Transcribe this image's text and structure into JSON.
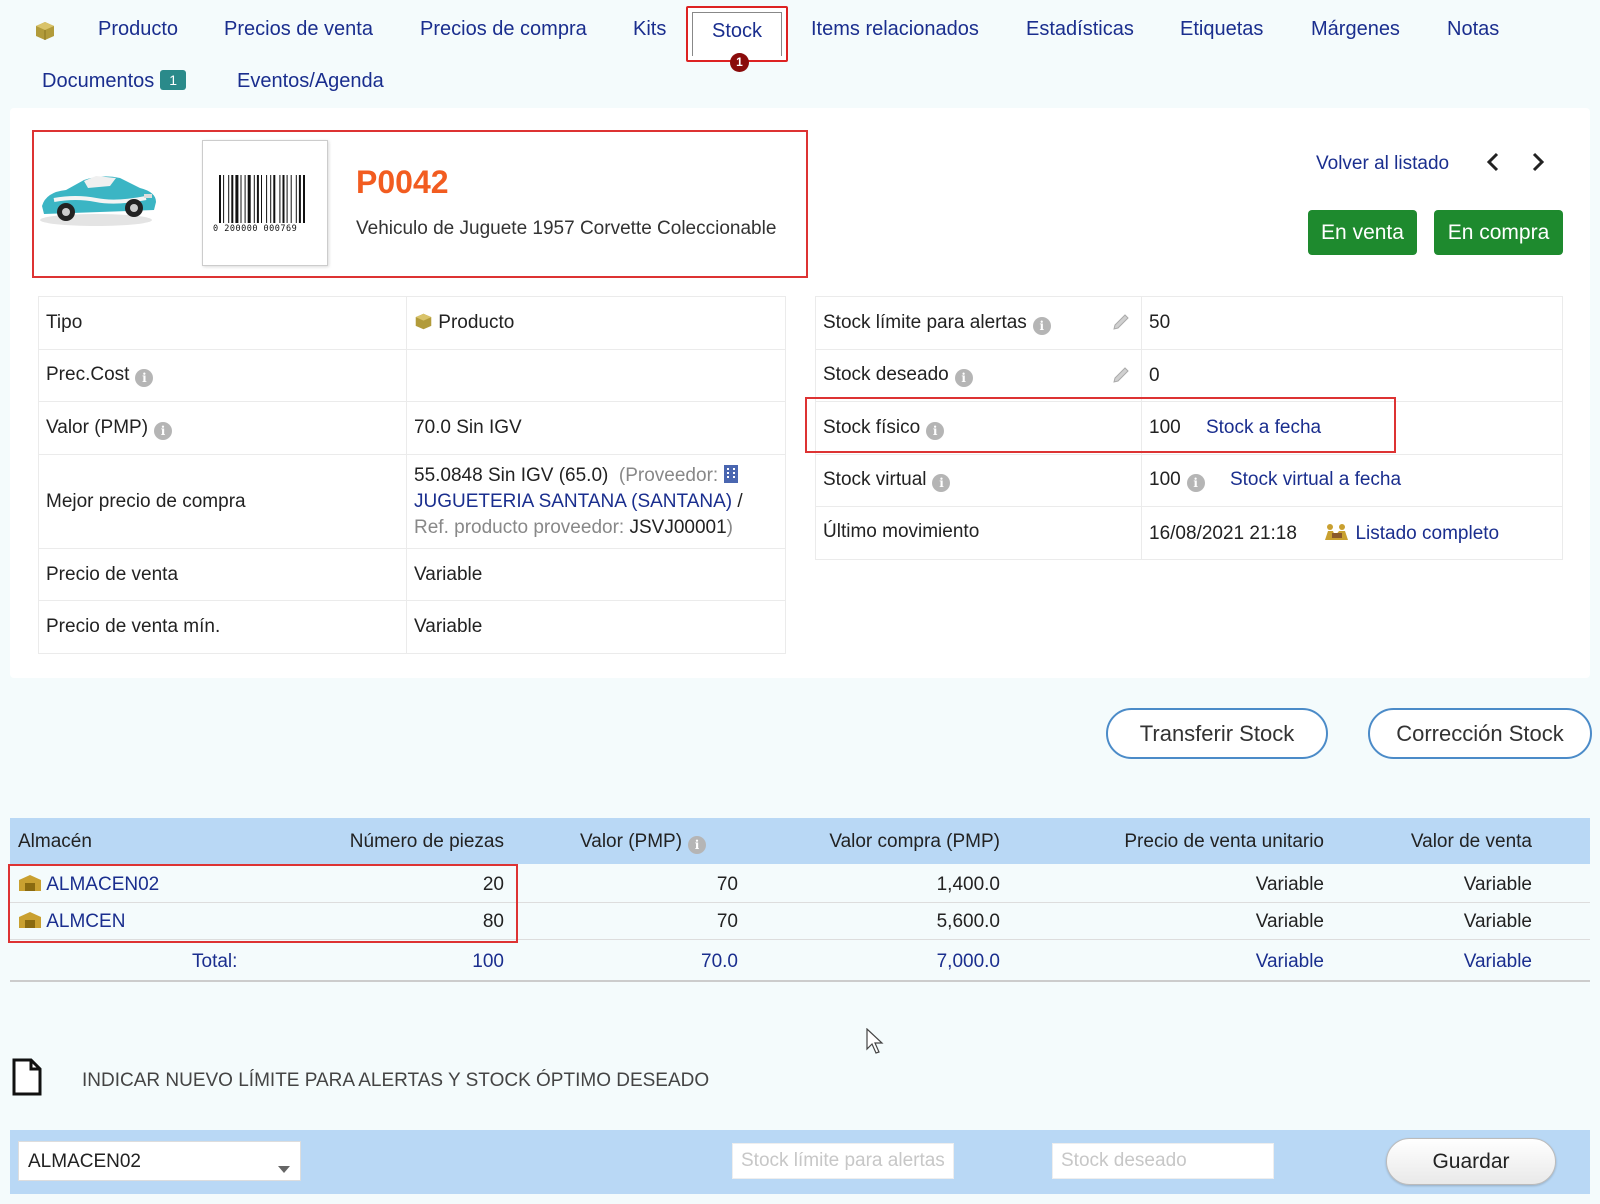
{
  "tabs": [
    {
      "label": "Producto"
    },
    {
      "label": "Precios de venta"
    },
    {
      "label": "Precios de compra"
    },
    {
      "label": "Kits"
    },
    {
      "label": "Stock",
      "active": true
    },
    {
      "label": "Items relacionados"
    },
    {
      "label": "Estadísticas"
    },
    {
      "label": "Etiquetas"
    },
    {
      "label": "Márgenes"
    },
    {
      "label": "Notas"
    },
    {
      "label": "Documentos",
      "badge": "1"
    },
    {
      "label": "Eventos/Agenda"
    }
  ],
  "active_tab_indicator": "1",
  "product": {
    "ref": "P0042",
    "description": "Vehiculo de Juguete 1957 Corvette Coleccionable",
    "barcode_number": "0 200000 000769"
  },
  "nav": {
    "back_label": "Volver al listado"
  },
  "status": {
    "sell": "En venta",
    "buy": "En compra"
  },
  "left_info": {
    "tipo_label": "Tipo",
    "tipo_value": "Producto",
    "prec_cost_label": "Prec.Cost",
    "pmp_label": "Valor (PMP)",
    "pmp_value": "70.0 Sin IGV",
    "best_price_label": "Mejor precio de compra",
    "best_price_value": "55.0848 Sin IGV (65.0)",
    "supplier_prefix": "(Proveedor:",
    "supplier_name": "JUGUETERIA SANTANA (SANTANA)",
    "supplier_sep": "/",
    "supplier_ref_label": "Ref. producto proveedor:",
    "supplier_ref": "JSVJ00001",
    "supplier_close": ")",
    "sell_price_label": "Precio de venta",
    "sell_price_value": "Variable",
    "sell_price_min_label": "Precio de venta mín.",
    "sell_price_min_value": "Variable"
  },
  "right_info": {
    "alert_label": "Stock límite para alertas",
    "alert_value": "50",
    "desired_label": "Stock deseado",
    "desired_value": "0",
    "physical_label": "Stock físico",
    "physical_value": "100",
    "physical_link": "Stock a fecha",
    "virtual_label": "Stock virtual",
    "virtual_value": "100",
    "virtual_link": "Stock virtual a fecha",
    "last_move_label": "Último movimiento",
    "last_move_value": "16/08/2021 21:18",
    "last_move_link": "Listado completo"
  },
  "actions": {
    "transfer": "Transferir Stock",
    "correction": "Corrección Stock"
  },
  "warehouse_table": {
    "headers": [
      "Almacén",
      "Número de piezas",
      "Valor (PMP)",
      "Valor compra (PMP)",
      "Precio de venta unitario",
      "Valor de venta"
    ],
    "rows": [
      {
        "name": "ALMACEN02",
        "qty": "20",
        "pmp": "70",
        "buy_value": "1,400.0",
        "unit_price": "Variable",
        "sell_value": "Variable"
      },
      {
        "name": "ALMCEN",
        "qty": "80",
        "pmp": "70",
        "buy_value": "5,600.0",
        "unit_price": "Variable",
        "sell_value": "Variable"
      }
    ],
    "total": {
      "label": "Total:",
      "qty": "100",
      "pmp": "70.0",
      "buy_value": "7,000.0",
      "unit_price": "Variable",
      "sell_value": "Variable"
    }
  },
  "limits_form": {
    "title": "INDICAR NUEVO LÍMITE PARA ALERTAS Y STOCK ÓPTIMO DESEADO",
    "warehouse_selected": "ALMACEN02",
    "alert_placeholder": "Stock límite para alertas",
    "desired_placeholder": "Stock deseado",
    "save_label": "Guardar"
  }
}
